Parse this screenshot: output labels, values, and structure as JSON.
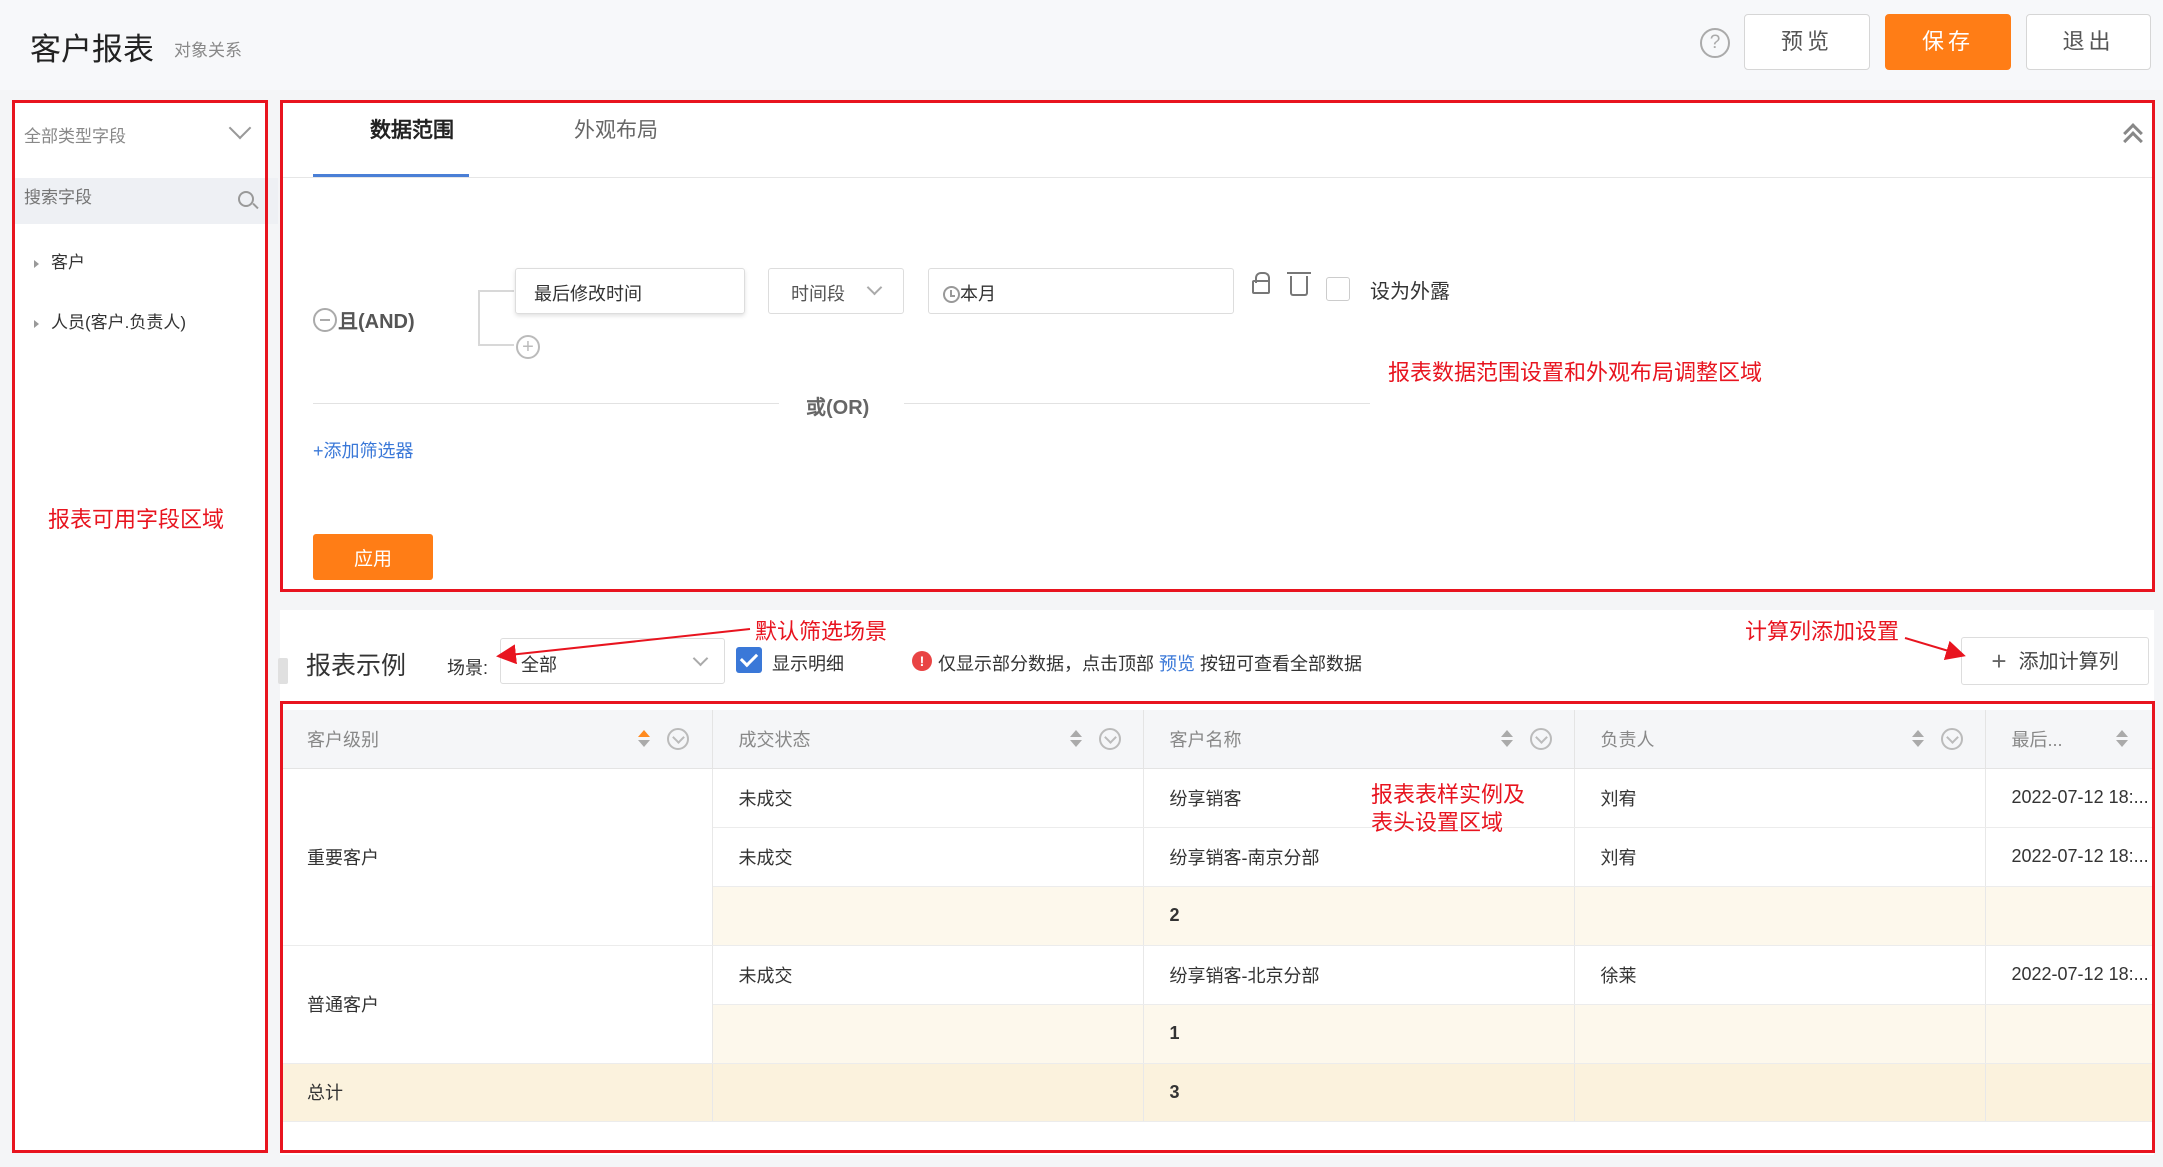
{
  "header": {
    "title": "客户报表",
    "subtitle": "对象关系",
    "help_icon": "question-circle-icon",
    "preview_label": "预览",
    "save_label": "保存",
    "exit_label": "退出",
    "accent_color": "#ff7d16"
  },
  "sidebar": {
    "field_type": "全部类型字段",
    "search_placeholder": "搜索字段",
    "items": [
      {
        "label": "客户"
      },
      {
        "label": "人员(客户.负责人)"
      }
    ]
  },
  "filter_panel": {
    "tabs": [
      {
        "label": "数据范围"
      },
      {
        "label": "外观布局"
      }
    ],
    "and_label": "且(AND)",
    "field": "最后修改时间",
    "operator": "时间段",
    "value": "本月",
    "expose_label": "设为外露",
    "or_label": "或(OR)",
    "add_filter_label": "+添加筛选器",
    "apply_label": "应用"
  },
  "report": {
    "title": "报表示例",
    "scene_label": "场景:",
    "scene_value": "全部",
    "show_detail_label": "显示明细",
    "note_prefix": "仅显示部分数据，点击顶部",
    "note_link": "预览",
    "note_suffix": "按钮可查看全部数据",
    "add_calc_label": "添加计算列",
    "columns": [
      "客户级别",
      "成交状态",
      "客户名称",
      "负责人",
      "最后..."
    ],
    "groups": [
      {
        "level": "重要客户",
        "rows": [
          {
            "status": "未成交",
            "name": "纷享销客",
            "owner": "刘宥",
            "time": "2022-07-12 18:..."
          },
          {
            "status": "未成交",
            "name": "纷享销客-南京分部",
            "owner": "刘宥",
            "time": "2022-07-12 18:..."
          }
        ],
        "subtotal": "2"
      },
      {
        "level": "普通客户",
        "rows": [
          {
            "status": "未成交",
            "name": "纷享销客-北京分部",
            "owner": "徐莱",
            "time": "2022-07-12 18:..."
          }
        ],
        "subtotal": "1"
      }
    ],
    "total_label": "总计",
    "total_value": "3"
  },
  "annotations": {
    "fields_area": "报表可用字段区域",
    "scope_area": "报表数据范围设置和外观布局调整区域",
    "default_scene": "默认筛选场景",
    "calc_column": "计算列添加设置",
    "table_area_line1": "报表表样实例及",
    "table_area_line2": "表头设置区域",
    "color": "#e8141f"
  }
}
